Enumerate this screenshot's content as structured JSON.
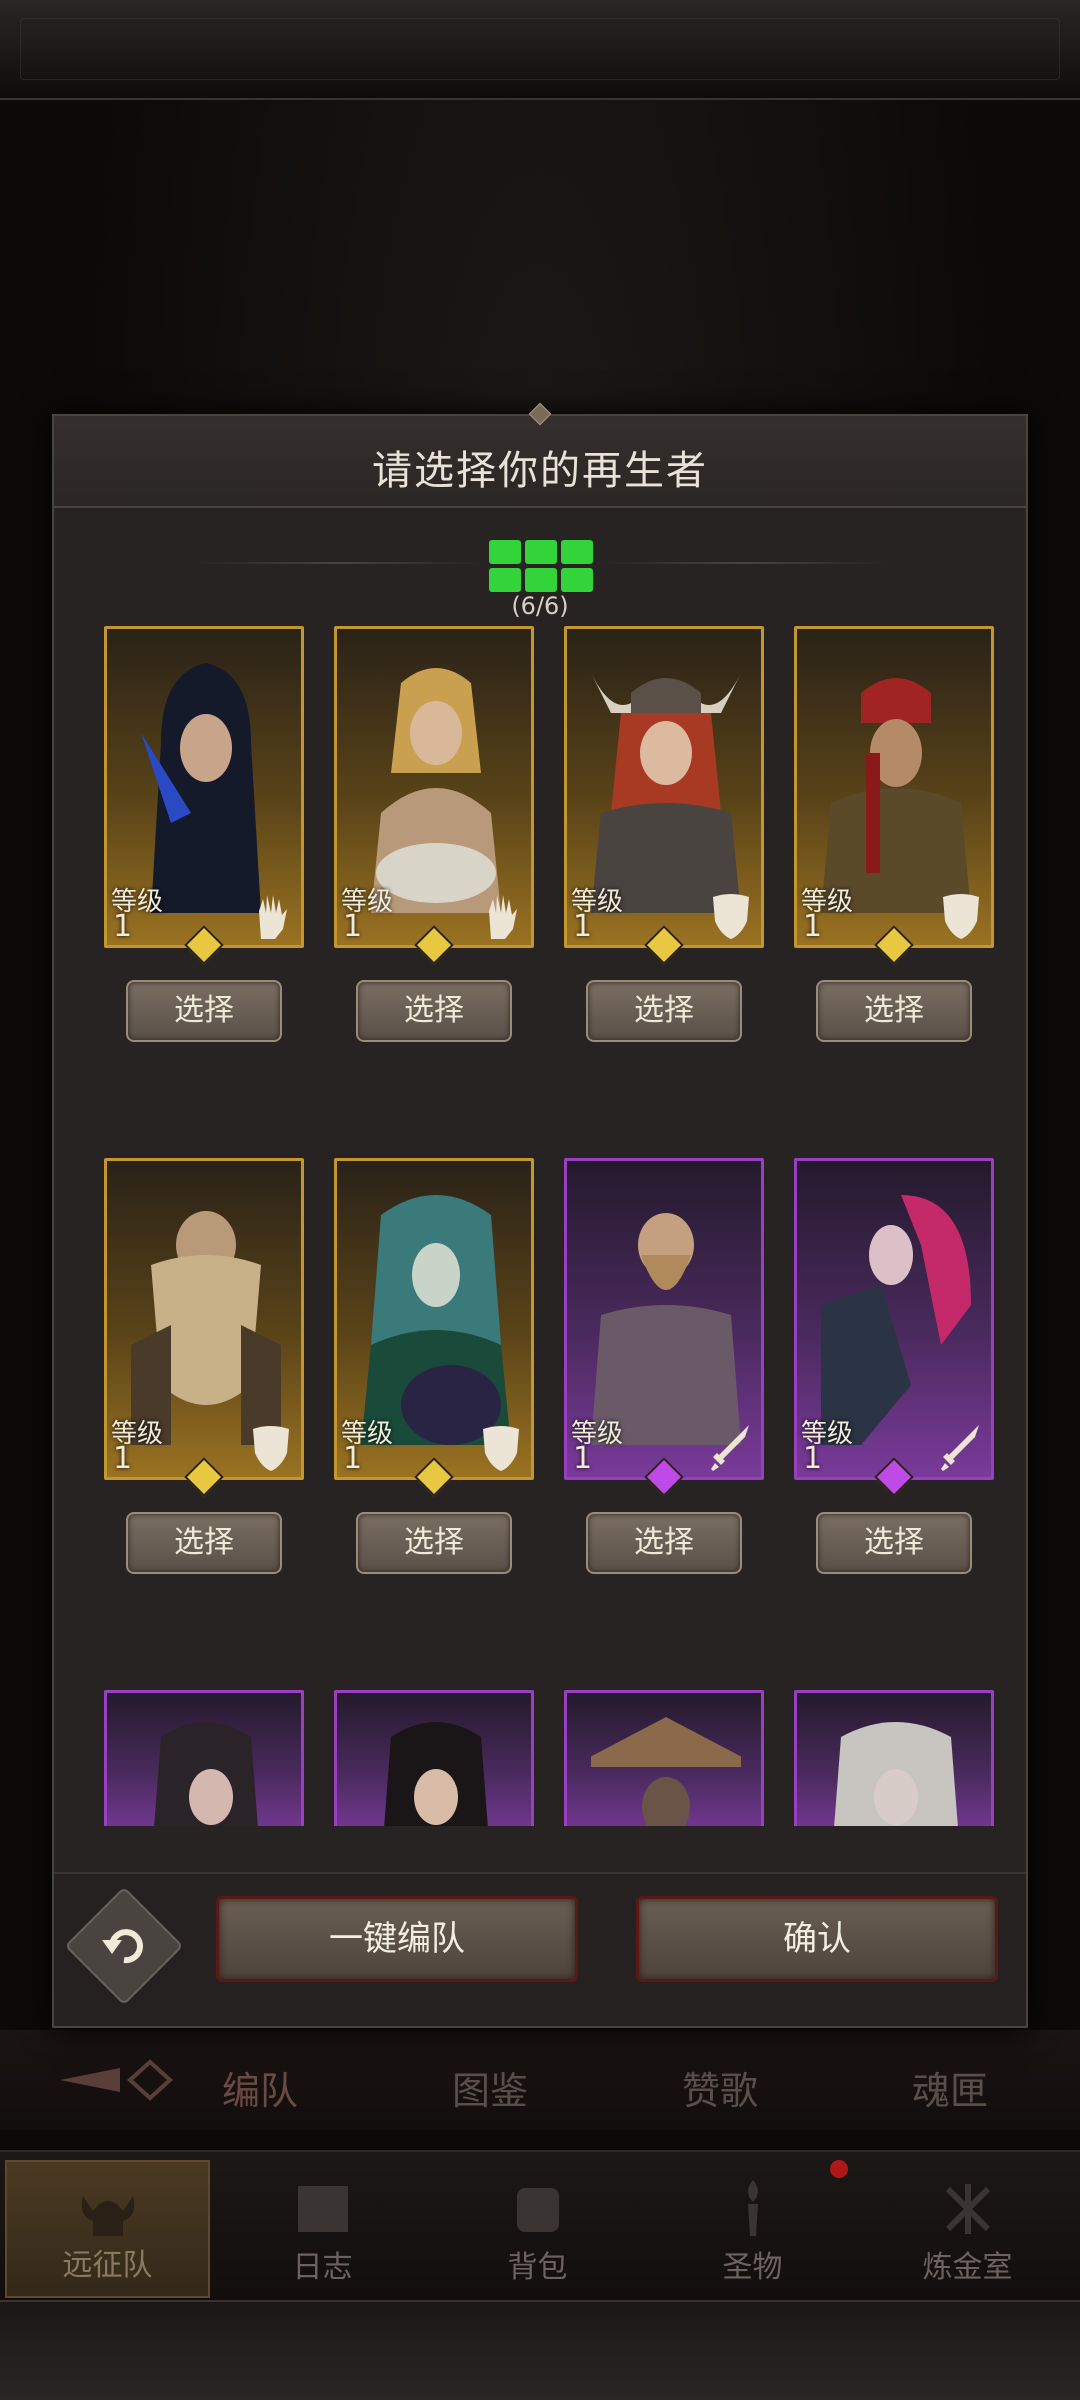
{
  "modal": {
    "title": "请选择你的再生者",
    "team_count": "(6/6)",
    "team_slots_filled": 6,
    "team_slots_total": 6,
    "auto_team_label": "一键编队",
    "confirm_label": "确认"
  },
  "heroes": [
    {
      "level_label": "等级",
      "level": "1",
      "rarity": "gold",
      "role_icon": "palm-icon",
      "select_label": "选择"
    },
    {
      "level_label": "等级",
      "level": "1",
      "rarity": "gold",
      "role_icon": "palm-icon",
      "select_label": "选择"
    },
    {
      "level_label": "等级",
      "level": "1",
      "rarity": "gold",
      "role_icon": "shield-icon",
      "select_label": "选择"
    },
    {
      "level_label": "等级",
      "level": "1",
      "rarity": "gold",
      "role_icon": "shield-icon",
      "select_label": "选择"
    },
    {
      "level_label": "等级",
      "level": "1",
      "rarity": "gold",
      "role_icon": "shield-icon",
      "select_label": "选择"
    },
    {
      "level_label": "等级",
      "level": "1",
      "rarity": "gold",
      "role_icon": "shield-icon",
      "select_label": "选择"
    },
    {
      "level_label": "等级",
      "level": "1",
      "rarity": "purple",
      "role_icon": "sword-icon",
      "select_label": "选择"
    },
    {
      "level_label": "等级",
      "level": "1",
      "rarity": "purple",
      "role_icon": "sword-icon",
      "select_label": "选择"
    },
    {
      "rarity": "purple"
    },
    {
      "rarity": "purple"
    },
    {
      "rarity": "purple"
    },
    {
      "rarity": "purple"
    }
  ],
  "sub_tabs": [
    "编队",
    "图鉴",
    "赞歌",
    "魂匣"
  ],
  "bottom_nav": [
    "远征队",
    "日志",
    "背包",
    "圣物",
    "炼金室"
  ],
  "colors": {
    "gold_frame": "#c4962e",
    "purple_frame": "#9a3ec4",
    "slot_green": "#33d43a",
    "button_border_red": "#5a1a14"
  }
}
